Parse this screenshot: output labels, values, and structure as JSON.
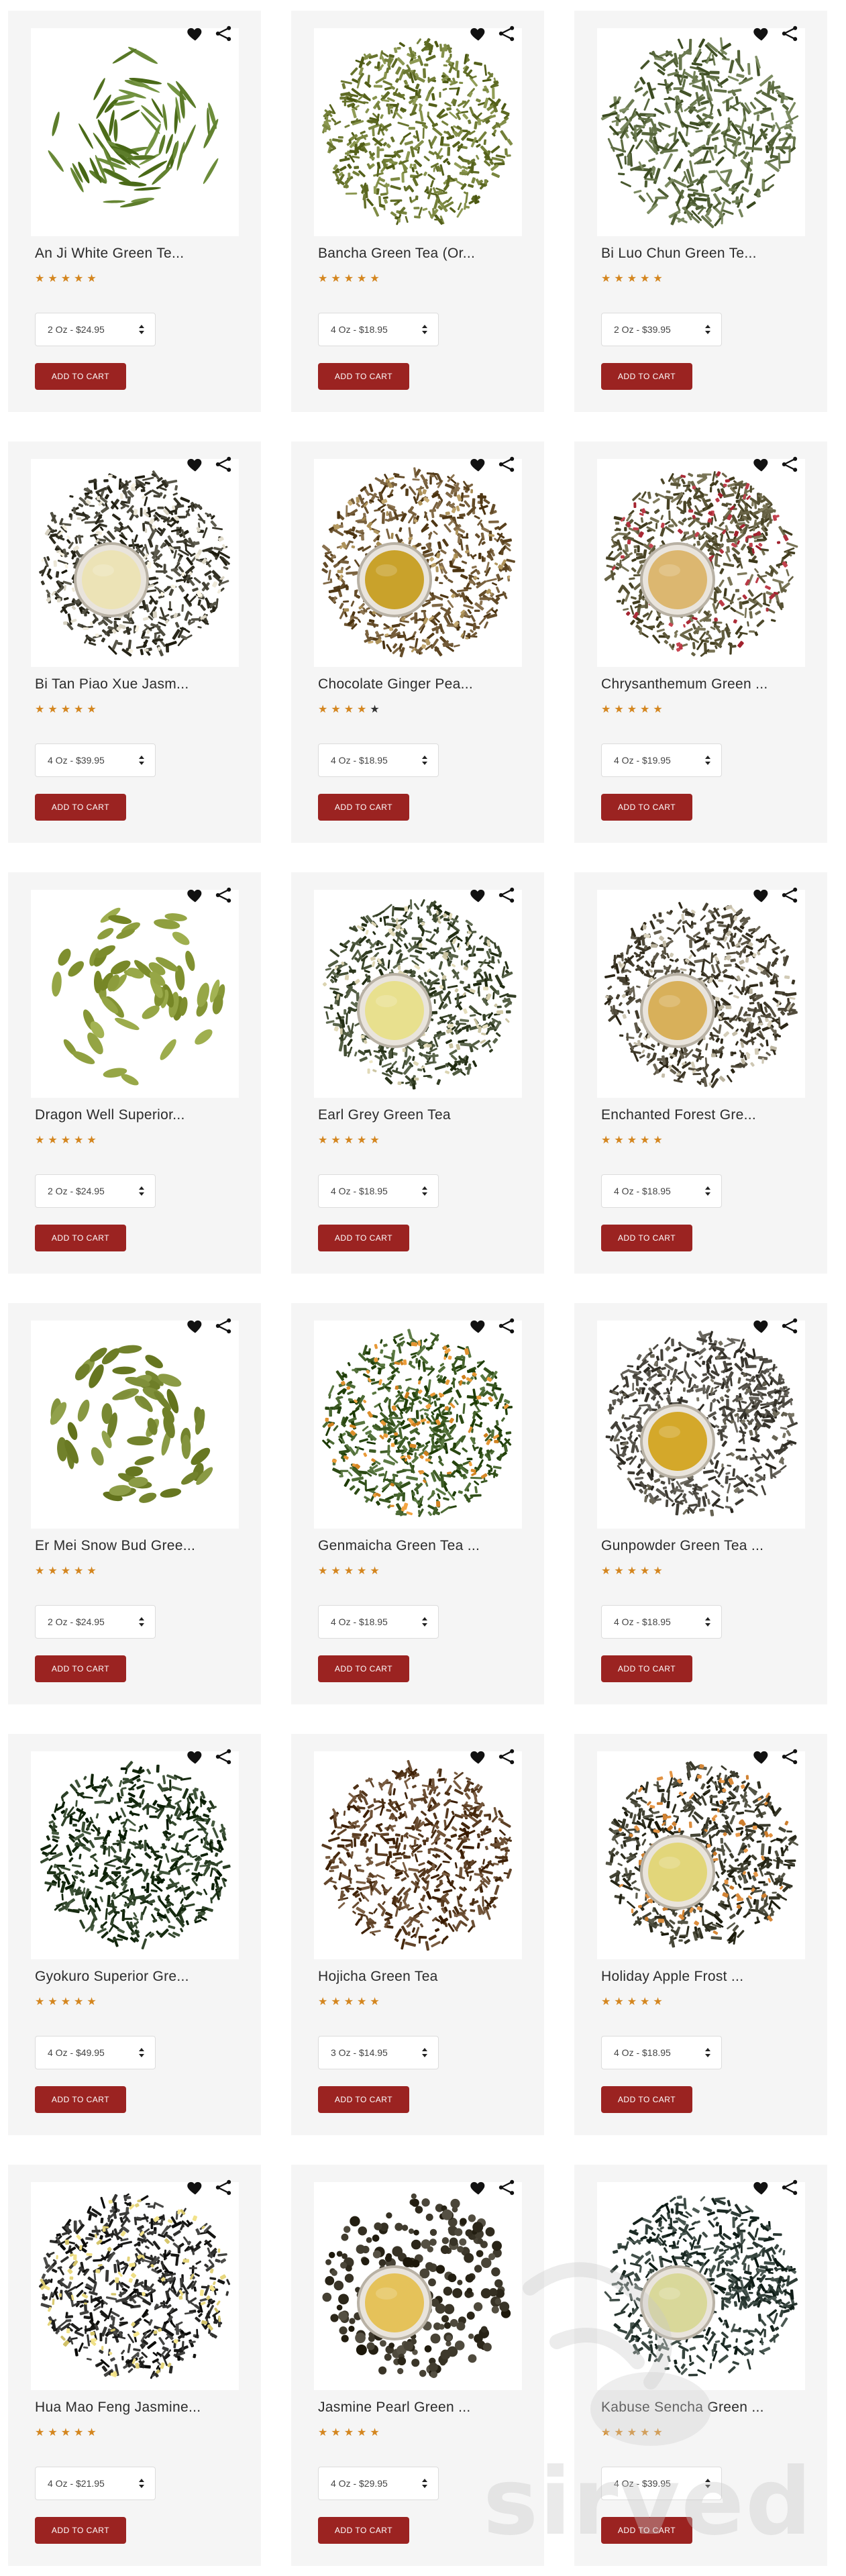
{
  "colors": {
    "accent": "#9b2321",
    "star_filled": "#d4861f",
    "star_empty": "#333333",
    "card_bg": "#f5f5f5",
    "brew_gold": "#e3c25a",
    "brew_pale": "#ece3b6"
  },
  "actions": {
    "favorite_icon": "heart-icon",
    "share_icon": "share-icon"
  },
  "add_to_cart_label": "ADD TO CART",
  "watermark": {
    "text": "sirved",
    "icon": "sirved-logo-icon"
  },
  "products": [
    {
      "name": "An Ji White Green Te...",
      "rating": 5,
      "variant": "2 Oz - $24.95",
      "image": {
        "style": "needles",
        "leaf": "#5f7f2d",
        "brew": false
      }
    },
    {
      "name": "Bancha Green Tea (Or...",
      "rating": 5,
      "variant": "4 Oz - $18.95",
      "image": {
        "style": "loose",
        "leaf": "#6e7a34",
        "brew": false
      }
    },
    {
      "name": "Bi Luo Chun Green Te...",
      "rating": 5,
      "variant": "2 Oz - $39.95",
      "image": {
        "style": "curly",
        "leaf": "#5d6c42",
        "brew": false
      }
    },
    {
      "name": "Bi Tan Piao Xue Jasm...",
      "rating": 5,
      "variant": "4 Oz - $39.95",
      "image": {
        "style": "blend",
        "leaf": "#3d3b2e",
        "accent_bits": "#e9e4d4",
        "brew": true,
        "brew_color": "#ece3b6"
      }
    },
    {
      "name": "Chocolate Ginger Pea...",
      "rating": 4,
      "variant": "4 Oz - $18.95",
      "image": {
        "style": "blend",
        "leaf": "#6b5330",
        "accent_bits": "#b59a62",
        "brew": true,
        "brew_color": "#c9a22b"
      }
    },
    {
      "name": "Chrysanthemum Green ...",
      "rating": 5,
      "variant": "4 Oz - $19.95",
      "image": {
        "style": "blend",
        "leaf": "#5f5a3c",
        "accent_bits": "#b3333f",
        "brew": true,
        "brew_color": "#dcb770"
      }
    },
    {
      "name": "Dragon Well Superior...",
      "rating": 5,
      "variant": "2 Oz - $24.95",
      "image": {
        "style": "flat",
        "leaf": "#8a9a3a",
        "brew": false
      }
    },
    {
      "name": "Earl Grey Green Tea",
      "rating": 5,
      "variant": "4 Oz - $18.95",
      "image": {
        "style": "blend",
        "leaf": "#3f4a30",
        "accent_bits": "#d9d2b0",
        "brew": true,
        "brew_color": "#e8e08e"
      }
    },
    {
      "name": "Enchanted Forest Gre...",
      "rating": 5,
      "variant": "4 Oz - $18.95",
      "image": {
        "style": "blend",
        "leaf": "#4a4434",
        "accent_bits": "#c9c2ae",
        "brew": true,
        "brew_color": "#d8b05a"
      }
    },
    {
      "name": "Er Mei Snow Bud Gree...",
      "rating": 5,
      "variant": "2 Oz - $24.95",
      "image": {
        "style": "flat",
        "leaf": "#7a8a34",
        "brew": false
      }
    },
    {
      "name": "Genmaicha Green Tea ...",
      "rating": 5,
      "variant": "4 Oz - $18.95",
      "image": {
        "style": "blend",
        "leaf": "#3c5a24",
        "accent_bits": "#e0912e",
        "brew": false
      }
    },
    {
      "name": "Gunpowder Green Tea ...",
      "rating": 5,
      "variant": "4 Oz - $18.95",
      "image": {
        "style": "blend",
        "leaf": "#4a473f",
        "accent_bits": "#6b6757",
        "brew": true,
        "brew_color": "#d4a82a"
      }
    },
    {
      "name": "Gyokuro Superior Gre...",
      "rating": 5,
      "variant": "4 Oz - $49.95",
      "image": {
        "style": "loose",
        "leaf": "#263a20",
        "brew": false
      }
    },
    {
      "name": "Hojicha Green Tea",
      "rating": 5,
      "variant": "3 Oz - $14.95",
      "image": {
        "style": "loose",
        "leaf": "#5a3d22",
        "brew": false
      }
    },
    {
      "name": "Holiday Apple Frost ...",
      "rating": 5,
      "variant": "4 Oz - $18.95",
      "image": {
        "style": "blend",
        "leaf": "#3b3b2c",
        "accent_bits": "#d98a3a",
        "brew": true,
        "brew_color": "#e2d67a"
      }
    },
    {
      "name": "Hua Mao Feng Jasmine...",
      "rating": 5,
      "variant": "4 Oz - $21.95",
      "image": {
        "style": "blend",
        "leaf": "#2a2a28",
        "accent_bits": "#e3d37a",
        "brew": false
      }
    },
    {
      "name": "Jasmine Pearl Green ...",
      "rating": 5,
      "variant": "4 Oz - $29.95",
      "image": {
        "style": "pearls",
        "leaf": "#3a3528",
        "brew": true,
        "brew_color": "#e5c25a"
      }
    },
    {
      "name": "Kabuse Sencha Green ...",
      "rating": 5,
      "variant": "4 Oz - $39.95",
      "image": {
        "style": "loose",
        "leaf": "#2c3a34",
        "brew": true,
        "brew_color": "#d9d89a"
      }
    }
  ]
}
